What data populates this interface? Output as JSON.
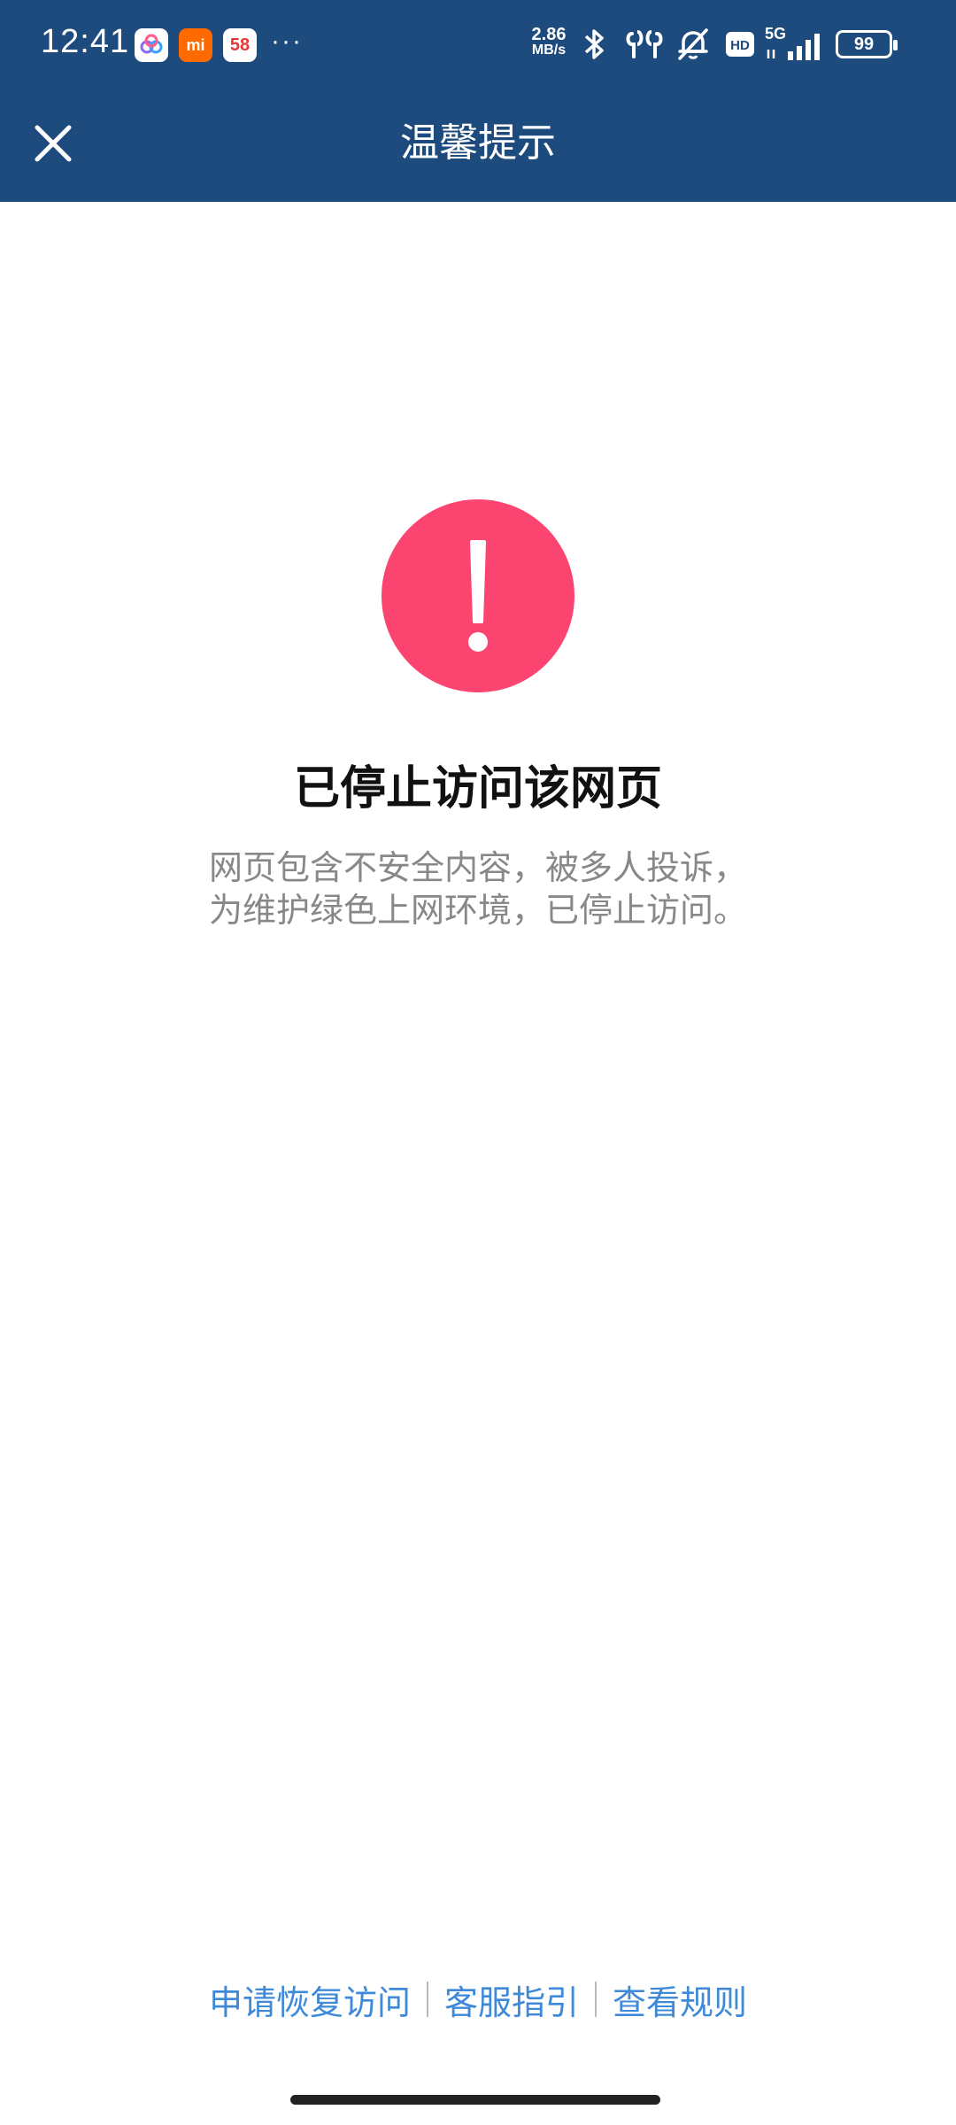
{
  "status_bar": {
    "time": "12:41",
    "more": "···",
    "net_speed_value": "2.86",
    "net_speed_unit": "MB/s",
    "hd_label": "HD",
    "network": "5G",
    "battery": "99",
    "icons": [
      "cloud-app-icon",
      "mi-app-icon",
      "app-58-icon",
      "bluetooth-icon",
      "earbuds-icon",
      "mute-bell-icon",
      "hd-icon",
      "signal-icon",
      "battery-icon"
    ],
    "app_58_label": "58",
    "mi_label": "mi"
  },
  "header": {
    "title": "温馨提示",
    "close_icon": "close-icon",
    "background": "#1e4b7d"
  },
  "alert": {
    "icon": "exclamation-icon",
    "color": "#fb4570",
    "headline": "已停止访问该网页",
    "description_line1": "网页包含不安全内容，被多人投诉，",
    "description_line2": "为维护绿色上网环境，已停止访问。"
  },
  "footer": {
    "links": [
      "申请恢复访问",
      "客服指引",
      "查看规则"
    ],
    "link_color": "#3f8ad8"
  }
}
